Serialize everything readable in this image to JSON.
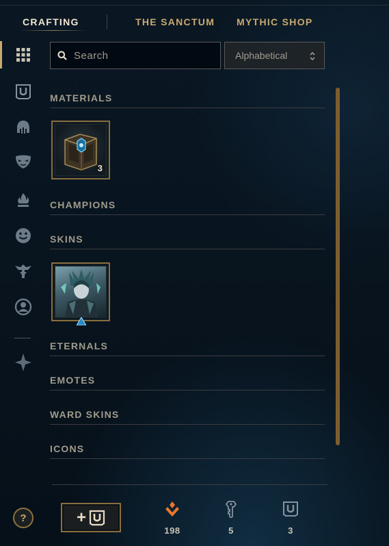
{
  "nav": {
    "tabs": [
      {
        "label": "CRAFTING",
        "active": true
      },
      {
        "label": "THE SANCTUM",
        "active": false
      },
      {
        "label": "MYTHIC SHOP",
        "active": false
      }
    ]
  },
  "rail": {
    "items": [
      {
        "icon": "grid-icon",
        "active": true
      },
      {
        "icon": "chest-icon",
        "active": false
      },
      {
        "icon": "helmet-icon",
        "active": false
      },
      {
        "icon": "mask-icon",
        "active": false
      },
      {
        "icon": "ward-flame-icon",
        "active": false
      },
      {
        "icon": "emote-face-icon",
        "active": false
      },
      {
        "icon": "totem-icon",
        "active": false
      },
      {
        "icon": "profile-icon",
        "active": false
      },
      {
        "icon": "eternals-icon",
        "active": false
      }
    ]
  },
  "search": {
    "placeholder": "Search",
    "value": ""
  },
  "sort": {
    "selected": "Alphabetical"
  },
  "sections": [
    {
      "title": "MATERIALS",
      "items": [
        {
          "name": "Hextech Chest",
          "count": "3"
        }
      ]
    },
    {
      "title": "CHAMPIONS",
      "items": []
    },
    {
      "title": "SKINS",
      "items": [
        {
          "name": "Skin Shard"
        }
      ]
    },
    {
      "title": "ETERNALS",
      "items": []
    },
    {
      "title": "EMOTES",
      "items": []
    },
    {
      "title": "WARD SKINS",
      "items": []
    },
    {
      "title": "ICONS",
      "items": []
    }
  ],
  "footer": {
    "help_label": "?",
    "add_label": "+",
    "currencies": [
      {
        "icon": "orange-essence-icon",
        "value": "198"
      },
      {
        "icon": "key-icon",
        "value": "5"
      },
      {
        "icon": "chest-icon",
        "value": "3"
      }
    ]
  },
  "colors": {
    "gold": "#c8aa6e",
    "gold_dark": "#8a6e3e",
    "text_light": "#f0e6d2",
    "text_muted": "#a09b8c",
    "orange_essence": "#e8772e",
    "background": "#07131e"
  }
}
